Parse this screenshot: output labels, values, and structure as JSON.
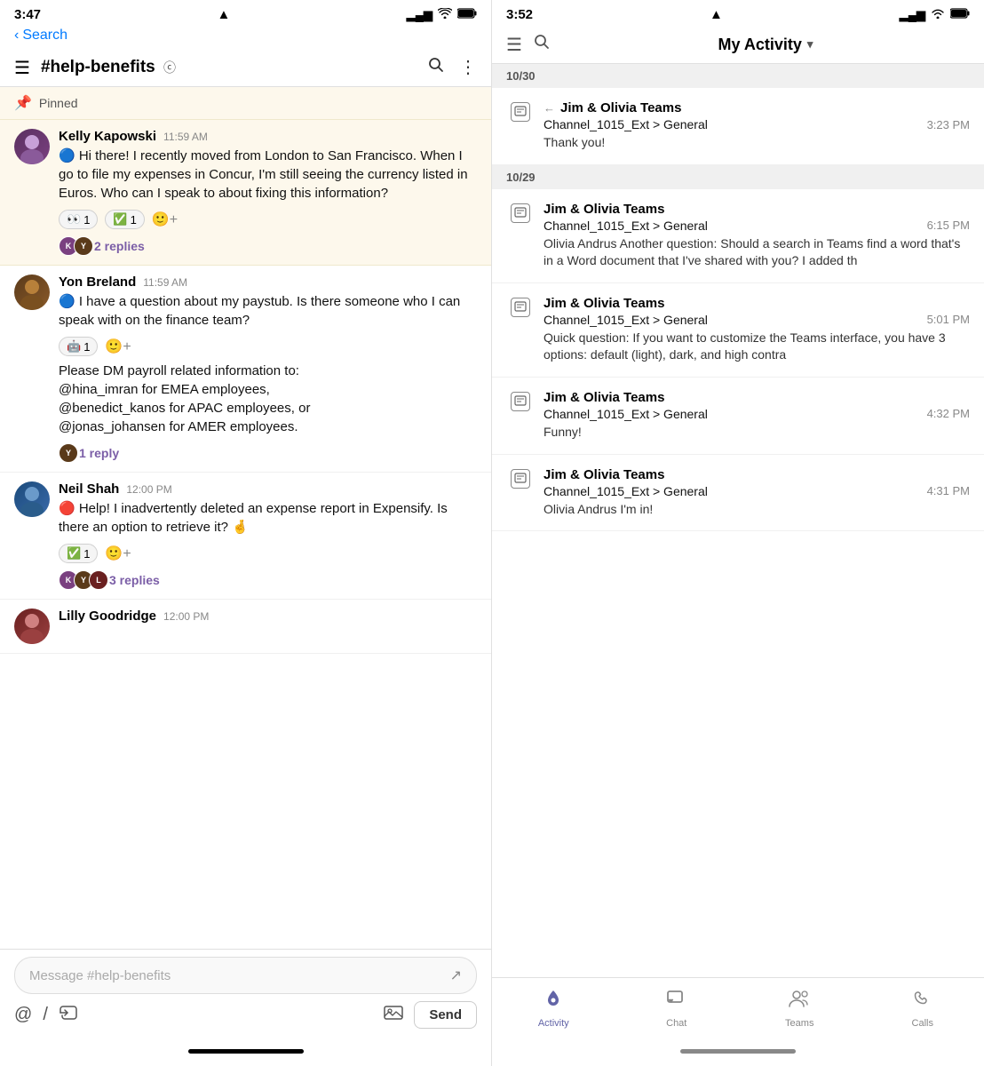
{
  "left": {
    "statusBar": {
      "time": "3:47",
      "locationIcon": "▲",
      "signalBars": "▂▄▆█",
      "wifi": "wifi",
      "battery": "battery"
    },
    "backLabel": "Search",
    "channelTitle": "#help-benefits",
    "verifiedIcon": "ⓒ",
    "searchIcon": "search",
    "moreIcon": "more",
    "pinned": {
      "label": "Pinned"
    },
    "messages": [
      {
        "id": "kelly",
        "author": "Kelly Kapowski",
        "time": "11:59 AM",
        "text": "🔵 Hi there! I recently moved from London to San Francisco. When I go to file my expenses in Concur, I'm still seeing the currency listed in Euros. Who can I speak to about fixing this information?",
        "reactions": [
          {
            "emoji": "👀",
            "count": "1"
          },
          {
            "emoji": "✅",
            "count": "1"
          }
        ],
        "hasAddReaction": true,
        "replies": {
          "count": "2 replies",
          "avatarColors": [
            "#7a4080",
            "#5a3a1a"
          ]
        },
        "pinned": true
      },
      {
        "id": "yon",
        "author": "Yon Breland",
        "time": "11:59 AM",
        "text": "🔵 I have a question about my paystub. Is there someone who I can speak with on the finance team?",
        "reactions": [
          {
            "emoji": "🤖",
            "count": "1"
          }
        ],
        "hasAddReaction": true,
        "extraText": "Please DM payroll related information to:\n@hina_imran for EMEA employees,\n@benedict_kanos for APAC employees, or\n@jonas_johansen for AMER employees.",
        "replies": {
          "count": "1 reply",
          "avatarColors": [
            "#5a3a1a"
          ]
        }
      },
      {
        "id": "neil",
        "author": "Neil Shah",
        "time": "12:00 PM",
        "text": "🔴 Help! I inadvertently deleted an expense report in Expensify. Is there an option to retrieve it? 🤞",
        "reactions": [
          {
            "emoji": "✅",
            "count": "1"
          }
        ],
        "hasAddReaction": true,
        "replies": {
          "count": "3 replies",
          "avatarColors": [
            "#7a4080",
            "#5a3a1a",
            "#6a2020"
          ]
        }
      },
      {
        "id": "lilly",
        "author": "Lilly Goodridge",
        "time": "12:00 PM",
        "text": "",
        "partial": true
      }
    ],
    "inputPlaceholder": "Message #help-benefits",
    "sendLabel": "Send"
  },
  "right": {
    "statusBar": {
      "time": "3:52",
      "locationIcon": "▲"
    },
    "header": {
      "title": "My Activity",
      "dropdownIcon": "▾"
    },
    "dates": [
      {
        "label": "10/30",
        "items": [
          {
            "type": "reply",
            "source": "Jim & Olivia Teams",
            "channel": "Channel_1015_Ext > General",
            "time": "3:23 PM",
            "preview": "Thank you!"
          }
        ]
      },
      {
        "label": "10/29",
        "items": [
          {
            "type": "message",
            "source": "Jim & Olivia Teams",
            "channel": "Channel_1015_Ext > General",
            "time": "6:15 PM",
            "preview": "Olivia Andrus Another question: Should a search in Teams find a word that's in a Word document that I've shared with you? I added th"
          },
          {
            "type": "message",
            "source": "Jim & Olivia Teams",
            "channel": "Channel_1015_Ext > General",
            "time": "5:01 PM",
            "preview": "Quick question: If you want to customize the Teams interface, you have 3 options: default (light), dark, and high contra"
          },
          {
            "type": "message",
            "source": "Jim & Olivia Teams",
            "channel": "Channel_1015_Ext > General",
            "time": "4:32 PM",
            "preview": "Funny!"
          },
          {
            "type": "message",
            "source": "Jim & Olivia Teams",
            "channel": "Channel_1015_Ext > General",
            "time": "4:31 PM",
            "preview": "Olivia Andrus I'm in!"
          }
        ]
      }
    ],
    "tabs": [
      {
        "id": "activity",
        "label": "Activity",
        "icon": "bell",
        "active": true
      },
      {
        "id": "chat",
        "label": "Chat",
        "icon": "chat",
        "active": false
      },
      {
        "id": "teams",
        "label": "Teams",
        "icon": "teams",
        "active": false
      },
      {
        "id": "calls",
        "label": "Calls",
        "icon": "phone",
        "active": false
      }
    ]
  }
}
